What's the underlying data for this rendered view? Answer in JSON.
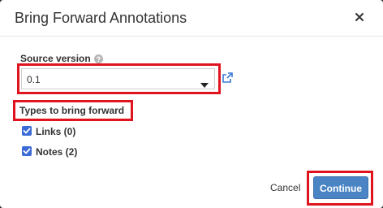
{
  "dialog": {
    "title": "Bring Forward Annotations",
    "close_icon": "close-icon"
  },
  "source": {
    "label": "Source version",
    "help_icon": "question-circle-icon",
    "selected_value": "0.1",
    "caret_icon": "caret-down-icon",
    "link_icon": "external-link-icon"
  },
  "types": {
    "label": "Types to bring forward",
    "options": [
      {
        "label": "Links (0)",
        "checked": true
      },
      {
        "label": "Notes (2)",
        "checked": true
      }
    ]
  },
  "footer": {
    "cancel_label": "Cancel",
    "continue_label": "Continue"
  },
  "colors": {
    "highlight": "#e0141f",
    "primary": "#4a84c4",
    "checkbox": "#3b6bd6",
    "link": "#3a7bd5"
  }
}
